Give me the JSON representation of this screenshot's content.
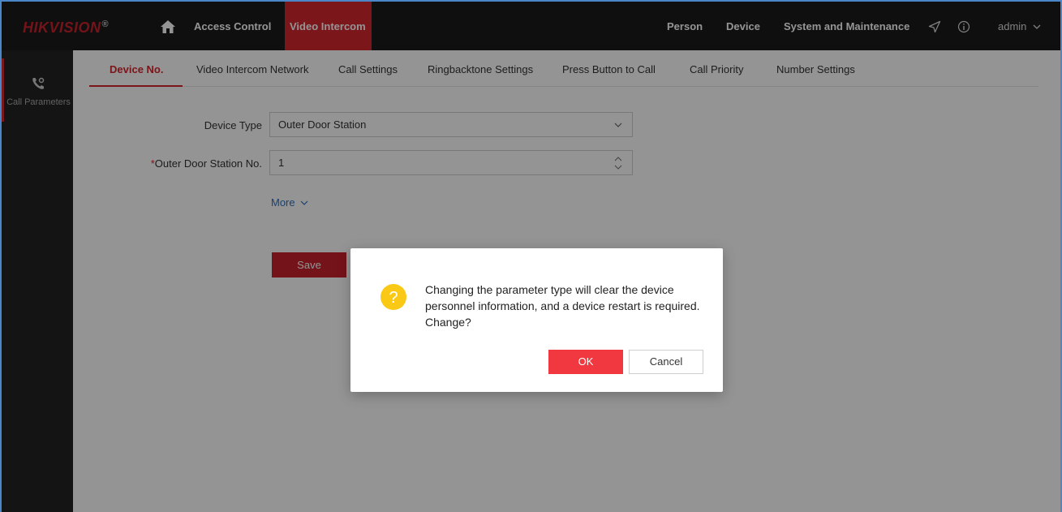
{
  "brand": {
    "name_a": "HIK",
    "name_b": "VISION",
    "reg": "®"
  },
  "topnav": {
    "items": [
      {
        "label": "Access Control"
      },
      {
        "label": "Video Intercom"
      }
    ],
    "right": [
      {
        "label": "Person"
      },
      {
        "label": "Device"
      },
      {
        "label": "System and Maintenance"
      }
    ],
    "user": "admin"
  },
  "sidebar": {
    "items": [
      {
        "label": "Call Parameters",
        "icon": "call-settings-icon"
      }
    ]
  },
  "tabs": [
    {
      "label": "Device No."
    },
    {
      "label": "Video Intercom Network"
    },
    {
      "label": "Call Settings"
    },
    {
      "label": "Ringbacktone Settings"
    },
    {
      "label": "Press Button to Call"
    },
    {
      "label": "Call Priority"
    },
    {
      "label": "Number Settings"
    }
  ],
  "form": {
    "device_type_label": "Device Type",
    "device_type_value": "Outer Door Station",
    "required_mark": "*",
    "station_no_label": "Outer Door Station No.",
    "station_no_value": "1",
    "more_label": "More",
    "save_label": "Save"
  },
  "dialog": {
    "message": "Changing the parameter type will clear the device personnel information, and a device restart is required. Change?",
    "ok_label": "OK",
    "cancel_label": "Cancel",
    "icon_glyph": "?"
  },
  "colors": {
    "brand_red": "#d5262f",
    "ok_red": "#f1373f",
    "warning_yellow": "#f9c916",
    "link_blue": "#2e6fbf"
  }
}
